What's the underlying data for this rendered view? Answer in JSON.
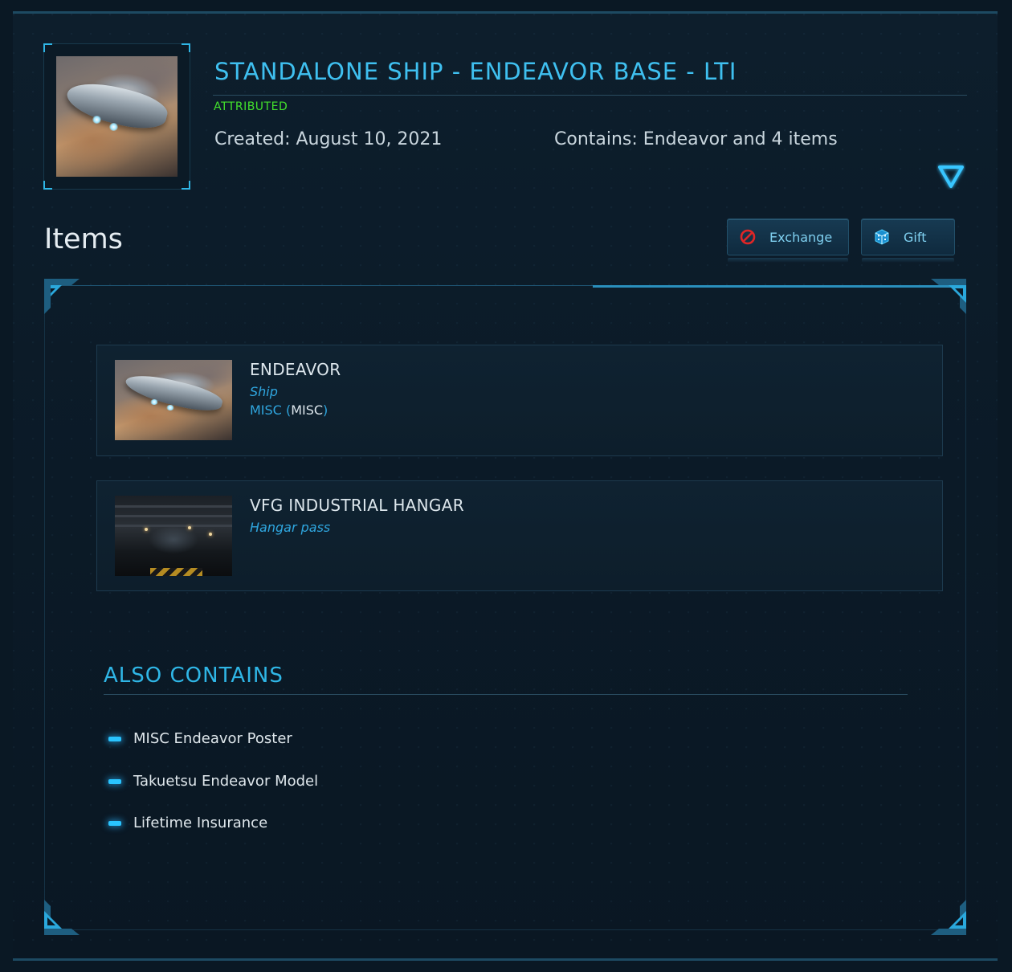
{
  "pledge": {
    "title": "STANDALONE SHIP - ENDEAVOR BASE - LTI",
    "status": "ATTRIBUTED",
    "created": "Created: August 10, 2021",
    "contains": "Contains: Endeavor and 4 items",
    "thumbnail": "endeavor-ship-image"
  },
  "colors": {
    "accent": "#2fb6e6",
    "status_green": "#42e02c",
    "background": "#0b1a27"
  },
  "items_section": {
    "heading": "Items",
    "actions": [
      {
        "label": "Exchange",
        "icon": "no-entry-icon"
      },
      {
        "label": "Gift",
        "icon": "gift-box-icon"
      }
    ]
  },
  "items": [
    {
      "name": "ENDEAVOR",
      "type": "Ship",
      "manufacturer": "MISC",
      "manufacturer_code": "MISC",
      "image": "endeavor-ship-image"
    },
    {
      "name": "VFG INDUSTRIAL HANGAR",
      "type": "Hangar pass",
      "image": "industrial-hangar-image"
    }
  ],
  "also_contains": {
    "heading": "ALSO CONTAINS",
    "entries": [
      "MISC Endeavor Poster",
      "Takuetsu Endeavor Model",
      "Lifetime Insurance"
    ]
  }
}
